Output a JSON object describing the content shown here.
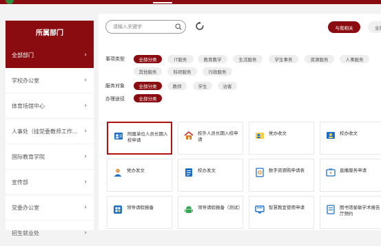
{
  "sidebar": {
    "title": "所属部门",
    "items": [
      {
        "label": "全部部门"
      },
      {
        "label": "学校办公室"
      },
      {
        "label": "体育场馆中心"
      },
      {
        "label": "人事处（挂党委教师工作..."
      },
      {
        "label": "国际教育学院"
      },
      {
        "label": "宣传部"
      },
      {
        "label": "党委办公室"
      },
      {
        "label": "招生就业处"
      }
    ],
    "chevron": "›"
  },
  "search": {
    "placeholder": "请输入关键字"
  },
  "buttons": {
    "related": "与我相关",
    "all": "全部"
  },
  "filters": {
    "type_label": "事项类型",
    "type_tags": [
      "全部分类",
      "IT服务",
      "教育教学",
      "生活服务",
      "学生事务",
      "资源服务",
      "人事服务",
      "其他服务",
      "科研服务",
      "行政服务"
    ],
    "target_label": "服务对象",
    "target_tags": [
      "全部分类",
      "教师",
      "学生",
      "访客"
    ],
    "channel_label": "办理途径",
    "channel_tags": [
      "全部分类"
    ]
  },
  "cards": [
    {
      "text": "附属单位人员长期入校申请",
      "icon": "person-card-icon"
    },
    {
      "text": "校外人员长期入校申请",
      "icon": "house-icon"
    },
    {
      "text": "党办收文",
      "icon": "person-card-icon"
    },
    {
      "text": "校办收文",
      "icon": "person-card-icon"
    },
    {
      "text": "党办发文",
      "icon": "person-icon"
    },
    {
      "text": "校办发文",
      "icon": "document-icon"
    },
    {
      "text": "数字资源购申请表",
      "icon": "form-icon"
    },
    {
      "text": "直播服务申请",
      "icon": "tv-icon"
    },
    {
      "text": "领导请假报备",
      "icon": "grid-icon"
    },
    {
      "text": "领导请假报备（测试）",
      "icon": "android-icon"
    },
    {
      "text": "智慧教室使用申请",
      "icon": "monitor-icon"
    },
    {
      "text": "图书馆星敏学术报告厅预约",
      "icon": "book-icon"
    }
  ],
  "colors": {
    "brand": "#8b0c10",
    "green": "#2e8b3e",
    "blue": "#1e6fc7",
    "orange": "#e07b1a"
  }
}
